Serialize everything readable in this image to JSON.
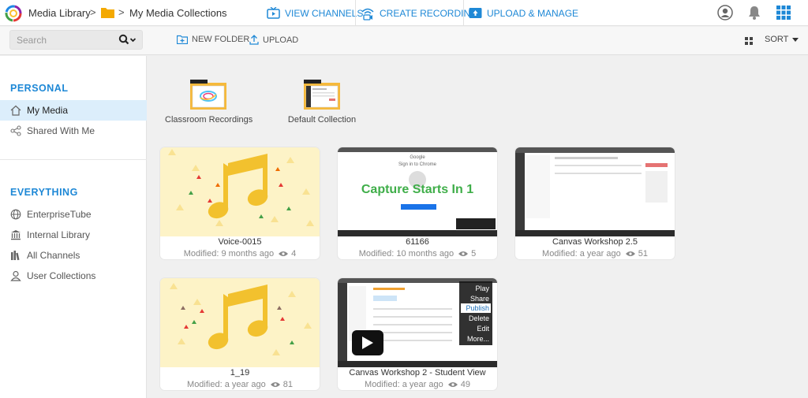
{
  "app": {
    "logo_icon": "media-library-logo"
  },
  "breadcrumb": {
    "root": "Media Library",
    "current": "My Media Collections",
    "separator": ">"
  },
  "topnav": {
    "view_channels": "VIEW CHANNELS",
    "create_recording": "CREATE RECORDING",
    "upload_manage": "UPLOAD & MANAGE"
  },
  "toolbar": {
    "search_placeholder": "Search",
    "new_folder": "NEW FOLDER",
    "upload": "UPLOAD",
    "sort": "SORT"
  },
  "sidebar": {
    "personal_title": "PERSONAL",
    "personal_items": [
      {
        "label": "My Media",
        "icon": "home-icon",
        "active": true
      },
      {
        "label": "Shared With Me",
        "icon": "share-icon",
        "active": false
      }
    ],
    "everything_title": "EVERYTHING",
    "everything_items": [
      {
        "label": "EnterpriseTube",
        "icon": "globe-icon"
      },
      {
        "label": "Internal Library",
        "icon": "library-icon"
      },
      {
        "label": "All Channels",
        "icon": "channels-icon"
      },
      {
        "label": "User Collections",
        "icon": "user-icon"
      }
    ]
  },
  "folders": [
    {
      "name": "Classroom Recordings"
    },
    {
      "name": "Default Collection"
    }
  ],
  "media": [
    {
      "title": "Voice-0015",
      "modified": "Modified: 9 months ago",
      "views": "4",
      "thumb": "audio"
    },
    {
      "title": "61166",
      "modified": "Modified: 10 months ago",
      "views": "5",
      "thumb": "capture"
    },
    {
      "title": "Canvas Workshop 2.5",
      "modified": "Modified: a year ago",
      "views": "51",
      "thumb": "screen"
    },
    {
      "title": "1_19",
      "modified": "Modified: a year ago",
      "views": "81",
      "thumb": "audio"
    },
    {
      "title": "Canvas Workshop 2 - Student View",
      "modified": "Modified: a year ago",
      "views": "49",
      "thumb": "video"
    }
  ],
  "capture_thumb": {
    "header": "Google",
    "subheader": "Sign in to Chrome",
    "overlay_text": "Capture Starts In 1"
  },
  "context_menu": [
    "Play",
    "Share",
    "Publish",
    "Delete",
    "Edit",
    "More..."
  ],
  "colors": {
    "accent": "#1e88d6",
    "active_bg": "#dceefb",
    "audio_bg": "#fdf3c7",
    "capture_green": "#3fae49"
  }
}
